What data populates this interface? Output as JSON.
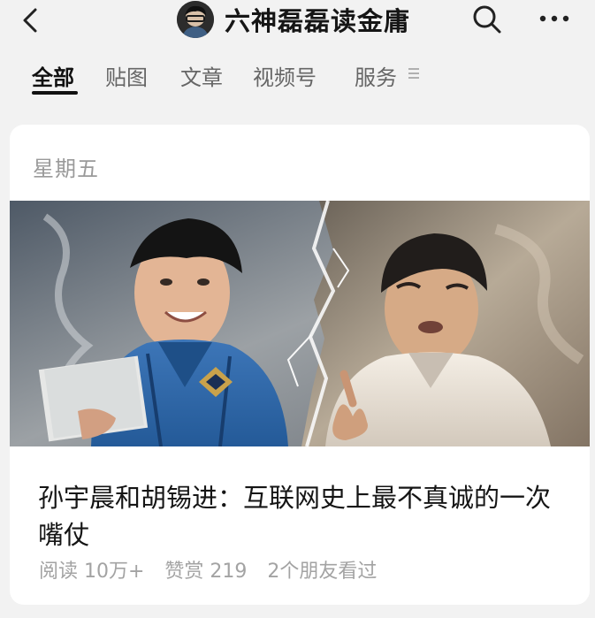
{
  "header": {
    "back_icon": "back-arrow-icon",
    "account_name": "六神磊磊读金庸",
    "avatar": "account-avatar",
    "search_icon": "search-icon",
    "more_icon": "more-icon"
  },
  "tabs": [
    {
      "label": "全部",
      "active": true
    },
    {
      "label": "贴图",
      "active": false
    },
    {
      "label": "文章",
      "active": false
    },
    {
      "label": "视频号",
      "active": false
    },
    {
      "label": "服务",
      "active": false
    }
  ],
  "tabs_menu_icon": "menu-lines-icon",
  "feed": {
    "date_label": "星期五",
    "article": {
      "title": "孙宇晨和胡锡进：互联网史上最不真诚的一次嘴仗",
      "reads": "阅读 10万+",
      "rewards": "赞赏 219",
      "friends": "2个朋友看过"
    }
  },
  "colors": {
    "background": "#f2f2f2",
    "card": "#ffffff",
    "text_primary": "#151515",
    "text_secondary": "#a3a3a3"
  }
}
